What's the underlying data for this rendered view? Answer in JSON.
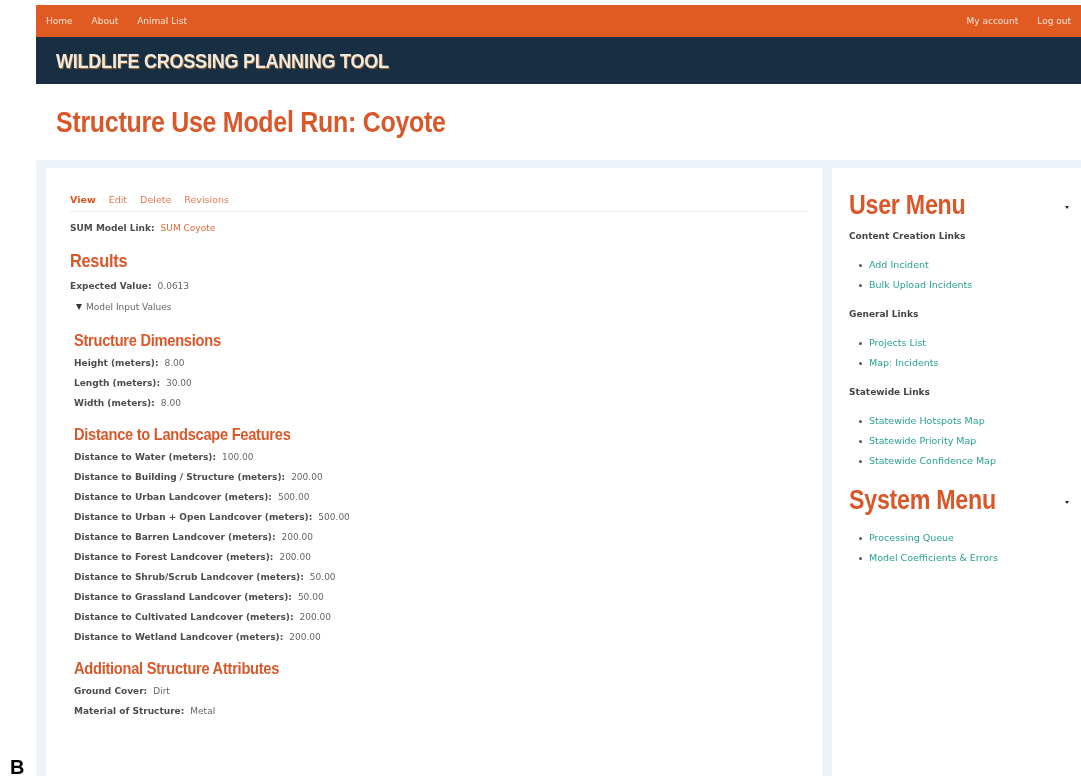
{
  "top_nav": {
    "left_links": [
      "Home",
      "About",
      "Animal List"
    ],
    "right_links": [
      "My account",
      "Log out"
    ]
  },
  "site_title": "WILDLIFE CROSSING PLANNING TOOL",
  "page_title": "Structure Use Model Run: Coyote",
  "tabs": [
    {
      "label": "View",
      "selected": true
    },
    {
      "label": "Edit",
      "selected": false
    },
    {
      "label": "Delete",
      "selected": false
    },
    {
      "label": "Revisions",
      "selected": false
    }
  ],
  "model_link": {
    "label": "SUM Model Link:",
    "value": "SUM Coyote"
  },
  "results": {
    "heading": "Results",
    "label": "Expected Value:",
    "value": "0.0613"
  },
  "details": {
    "summary": "Model Input Values",
    "expanded": true,
    "sections": [
      {
        "heading": "Structure Dimensions",
        "fields": [
          {
            "label": "Height (meters):",
            "value": "8.00"
          },
          {
            "label": "Length (meters):",
            "value": "30.00"
          },
          {
            "label": "Width (meters):",
            "value": "8.00"
          }
        ]
      },
      {
        "heading": "Distance to Landscape Features",
        "fields": [
          {
            "label": "Distance to Water (meters):",
            "value": "100.00"
          },
          {
            "label": "Distance to Building / Structure (meters):",
            "value": "200.00"
          },
          {
            "label": "Distance to Urban Landcover (meters):",
            "value": "500.00"
          },
          {
            "label": "Distance to Urban + Open Landcover (meters):",
            "value": "500.00"
          },
          {
            "label": "Distance to Barren Landcover (meters):",
            "value": "200.00"
          },
          {
            "label": "Distance to Forest Landcover (meters):",
            "value": "200.00"
          },
          {
            "label": "Distance to Shrub/Scrub Landcover (meters):",
            "value": "50.00"
          },
          {
            "label": "Distance to Grassland Landcover (meters):",
            "value": "50.00"
          },
          {
            "label": "Distance to Cultivated Landcover (meters):",
            "value": "200.00"
          },
          {
            "label": "Distance to Wetland Landcover (meters):",
            "value": "200.00"
          }
        ]
      },
      {
        "heading": "Additional Structure Attributes",
        "fields": [
          {
            "label": "Ground Cover:",
            "value": "Dirt"
          },
          {
            "label": "Material of Structure:",
            "value": "Metal"
          }
        ]
      }
    ]
  },
  "sidebar": [
    {
      "title": "User Menu",
      "groups": [
        {
          "heading": "Content Creation Links",
          "links": [
            "Add Incident",
            "Bulk Upload Incidents"
          ]
        },
        {
          "heading": "General Links",
          "links": [
            "Projects List",
            "Map: Incidents"
          ]
        },
        {
          "heading": "Statewide Links",
          "links": [
            "Statewide Hotspots Map",
            "Statewide Priority Map",
            "Statewide Confidence Map"
          ]
        }
      ]
    },
    {
      "title": "System Menu",
      "groups": [
        {
          "links": [
            "Processing Queue",
            "Model Coefficients & Errors"
          ]
        }
      ]
    }
  ],
  "panel_label": "B"
}
